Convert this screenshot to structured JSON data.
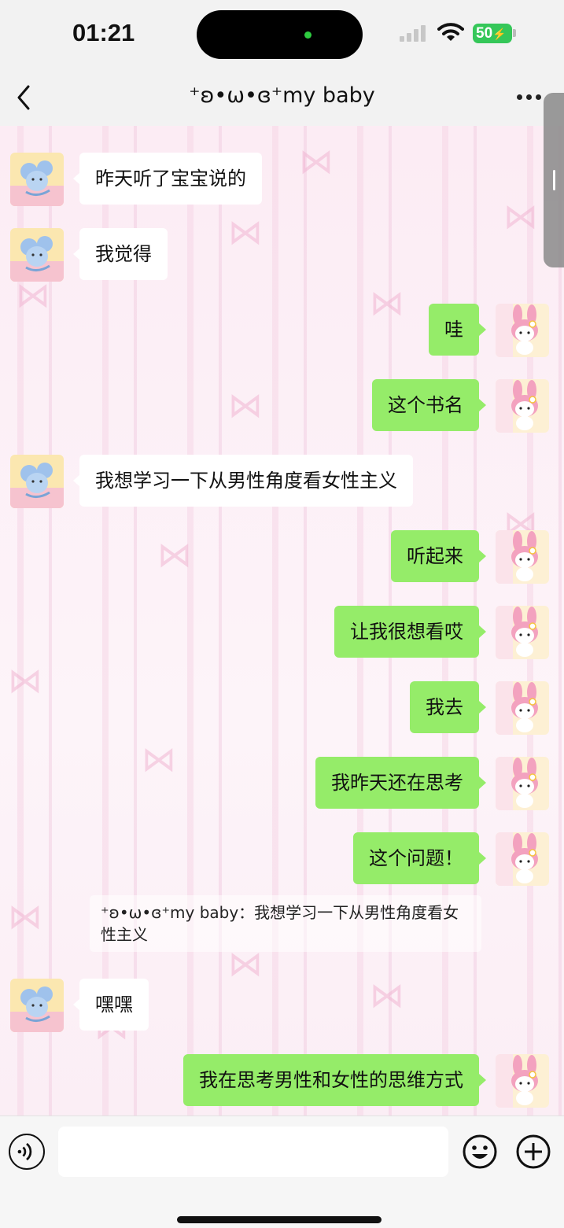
{
  "status_bar": {
    "time": "01:21",
    "battery": "50"
  },
  "header": {
    "title": "⁺ʚ•ω•ɞ⁺my baby"
  },
  "messages": [
    {
      "side": "left",
      "text": "昨天听了宝宝说的"
    },
    {
      "side": "left",
      "text": "我觉得"
    },
    {
      "side": "right",
      "text": "哇"
    },
    {
      "side": "right",
      "text": "这个书名"
    },
    {
      "side": "left",
      "text": "我想学习一下从男性角度看女性主义"
    },
    {
      "side": "right",
      "text": "听起来"
    },
    {
      "side": "right",
      "text": "让我很想看哎"
    },
    {
      "side": "right",
      "text": "我去"
    },
    {
      "side": "right",
      "text": "我昨天还在思考"
    },
    {
      "side": "right",
      "text": "这个问题！"
    },
    {
      "side": "left",
      "text": "嘿嘿"
    },
    {
      "side": "right",
      "text": "我在思考男性和女性的思维方式"
    }
  ],
  "quote": {
    "text": "⁺ʚ•ω•ɞ⁺my baby：我想学习一下从男性角度看女性主义"
  },
  "input": {
    "value": ""
  },
  "icons": {
    "back": "chevron-left-icon",
    "more": "more-dots-icon",
    "voice": "voice-icon",
    "emoji": "emoji-icon",
    "add": "plus-icon",
    "left_avatar": "mouse-avatar-icon",
    "right_avatar": "melody-avatar-icon"
  },
  "colors": {
    "sent_bubble": "#95ec69",
    "received_bubble": "#ffffff",
    "battery": "#35c759"
  }
}
